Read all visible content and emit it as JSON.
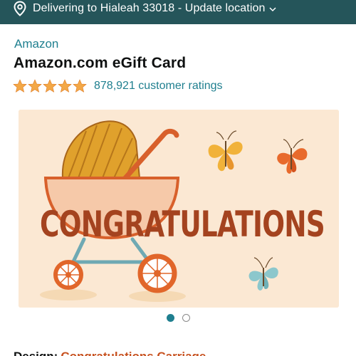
{
  "delivery": {
    "text": "Delivering to Hialeah 33018 - Update location",
    "icon": "location-pin-icon"
  },
  "product": {
    "brand": "Amazon",
    "title": "Amazon.com eGift Card",
    "rating_stars": 5,
    "rating_count": "878,921 customer ratings"
  },
  "image": {
    "card_text": "CONGRATULATIONS",
    "carousel": {
      "total": 2,
      "active": 1
    }
  },
  "design": {
    "label": "Design:",
    "value": "Congratulations Carriage"
  },
  "colors": {
    "header_bg": "#25555a",
    "link": "#1f7f8f",
    "star": "#f3a847",
    "accent": "#c7511f"
  }
}
